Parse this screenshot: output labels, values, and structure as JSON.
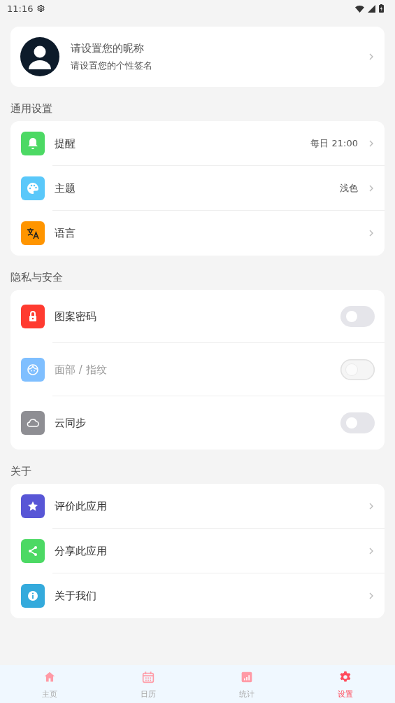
{
  "status_bar": {
    "time": "11:16"
  },
  "profile": {
    "nickname": "请设置您的昵称",
    "signature": "请设置您的个性签名"
  },
  "sections": [
    {
      "title": "通用设置",
      "items": [
        {
          "kind": "link",
          "label": "提醒",
          "value": "每日 21:00",
          "color": "#4cd964"
        },
        {
          "kind": "link",
          "label": "主题",
          "value": "浅色",
          "color": "#5ac8fa"
        },
        {
          "kind": "link",
          "label": "语言",
          "color": "#ff9500"
        }
      ]
    },
    {
      "title": "隐私与安全",
      "items": [
        {
          "kind": "toggle",
          "label": "图案密码",
          "on": false,
          "disabled": false,
          "color": "#ff3b30"
        },
        {
          "kind": "toggle",
          "label": "面部 / 指纹",
          "on": false,
          "disabled": true,
          "color": "#7fbfff"
        },
        {
          "kind": "toggle",
          "label": "云同步",
          "on": false,
          "disabled": false,
          "color": "#8e8e93"
        }
      ]
    },
    {
      "title": "关于",
      "items": [
        {
          "kind": "link",
          "label": "评价此应用",
          "color": "#5856d6"
        },
        {
          "kind": "link",
          "label": "分享此应用",
          "color": "#4cd964"
        },
        {
          "kind": "link",
          "label": "关于我们",
          "color": "#34aadc"
        }
      ]
    }
  ],
  "tabs": [
    {
      "label": "主页",
      "selected": false
    },
    {
      "label": "日历",
      "selected": false
    },
    {
      "label": "统计",
      "selected": false
    },
    {
      "label": "设置",
      "selected": true
    }
  ]
}
